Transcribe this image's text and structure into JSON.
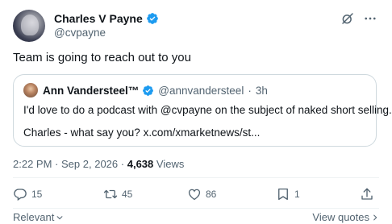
{
  "author": {
    "name": "Charles V Payne",
    "handle": "@cvpayne"
  },
  "tweet": {
    "text": "Team is going to reach out to you"
  },
  "quote": {
    "name": "Ann Vandersteel™",
    "handle": "@annvandersteel",
    "separator": "·",
    "time": "3h",
    "line1": "I'd love to do a podcast with @cvpayne on the subject of naked short selling.",
    "line2": "Charles - what say you? x.com/xmarketnews/st..."
  },
  "meta": {
    "time": "2:22 PM",
    "separator": "·",
    "date": "Sep 2, 2026",
    "separator2": "·",
    "views_count": "4,638",
    "views_label": "Views"
  },
  "actions": {
    "replies": "15",
    "reposts": "45",
    "likes": "86",
    "bookmarks": "1"
  },
  "footer": {
    "sort_label": "Relevant",
    "view_quotes_label": "View quotes"
  },
  "colors": {
    "verified": "#1d9bf0",
    "secondary_text": "#536471",
    "primary_text": "#0f1419",
    "border": "#cfd9de"
  },
  "icons": [
    "grok-icon",
    "more-icon",
    "verified-icon",
    "reply-icon",
    "repost-icon",
    "like-icon",
    "bookmark-icon",
    "share-icon",
    "chevron-down-icon",
    "chevron-right-icon"
  ]
}
